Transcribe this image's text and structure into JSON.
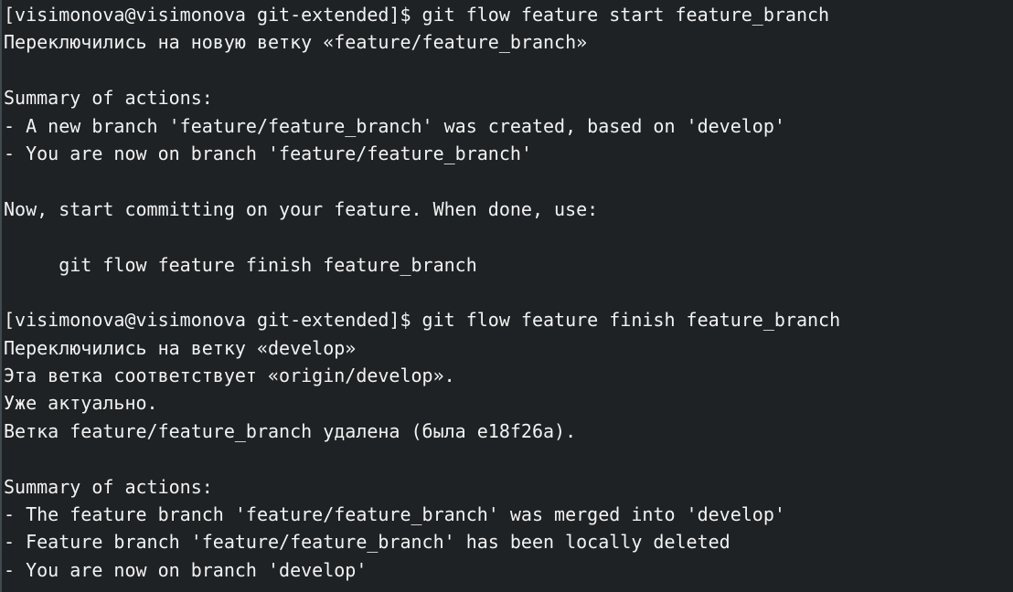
{
  "terminal": {
    "lines": [
      "[visimonova@visimonova git-extended]$ git flow feature start feature_branch",
      "Переключились на новую ветку «feature/feature_branch»",
      "",
      "Summary of actions:",
      "- A new branch 'feature/feature_branch' was created, based on 'develop'",
      "- You are now on branch 'feature/feature_branch'",
      "",
      "Now, start committing on your feature. When done, use:",
      "",
      "     git flow feature finish feature_branch",
      "",
      "[visimonova@visimonova git-extended]$ git flow feature finish feature_branch",
      "Переключились на ветку «develop»",
      "Эта ветка соответствует «origin/develop».",
      "Уже актуально.",
      "Ветка feature/feature_branch удалена (была e18f26a).",
      "",
      "Summary of actions:",
      "- The feature branch 'feature/feature_branch' was merged into 'develop'",
      "- Feature branch 'feature/feature_branch' has been locally deleted",
      "- You are now on branch 'develop'"
    ]
  }
}
